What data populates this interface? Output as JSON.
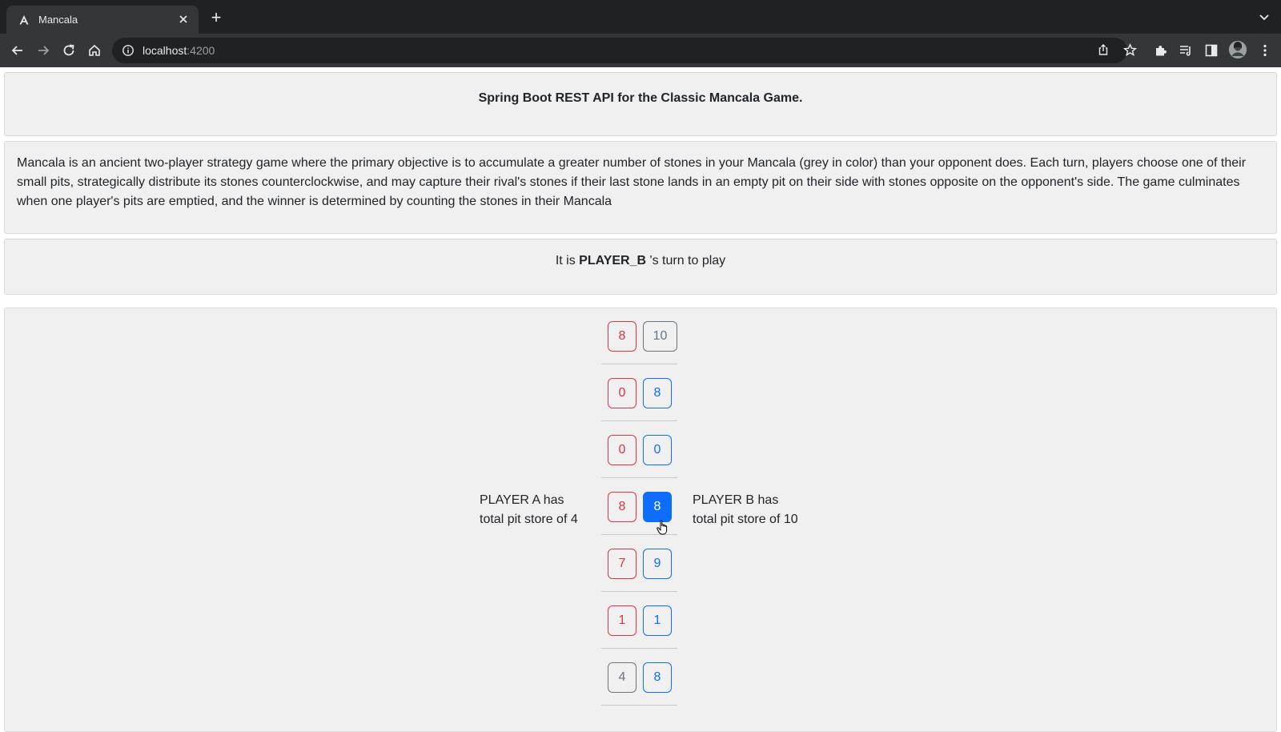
{
  "browser": {
    "tab_title": "Mancala",
    "new_tab_label": "+",
    "url_host": "localhost",
    "url_port": ":4200"
  },
  "header": {
    "title": "Spring Boot REST API for the Classic Mancala Game."
  },
  "description": {
    "text": "Mancala is an ancient two-player strategy game where the primary objective is to accumulate a greater number of stones in your Mancala (grey in color) than your opponent does. Each turn, players choose one of their small pits, strategically distribute its stones counterclockwise, and may capture their rival's stones if their last stone lands in an empty pit on their side with stones opposite on the opponent's side. The game culminates when one player's pits are emptied, and the winner is determined by counting the stones in their Mancala"
  },
  "turn": {
    "prefix": "It is",
    "player": "PLAYER_B",
    "suffix": "'s turn to play"
  },
  "board": {
    "rows": [
      {
        "a": "8",
        "b": "10"
      },
      {
        "a": "0",
        "b": "8"
      },
      {
        "a": "0",
        "b": "0"
      },
      {
        "a": "8",
        "b": "8"
      },
      {
        "a": "7",
        "b": "9"
      },
      {
        "a": "1",
        "b": "1"
      },
      {
        "a": "4",
        "b": "8"
      }
    ],
    "player_a": {
      "line1": "PLAYER A has",
      "line2": "total pit store of 4"
    },
    "player_b": {
      "line1": "PLAYER B has",
      "line2": "total pit store of 10"
    }
  },
  "colors": {
    "player_a": "#dc3545",
    "player_b": "#0d6efd",
    "store": "#6c757d"
  },
  "icons": [
    "angular-favicon",
    "close-icon",
    "back-icon",
    "forward-icon",
    "reload-icon",
    "home-icon",
    "info-icon",
    "share-icon",
    "star-icon",
    "extensions-icon",
    "reading-list-icon",
    "side-panel-icon",
    "avatar",
    "more-vert-icon",
    "hand-cursor-icon"
  ]
}
